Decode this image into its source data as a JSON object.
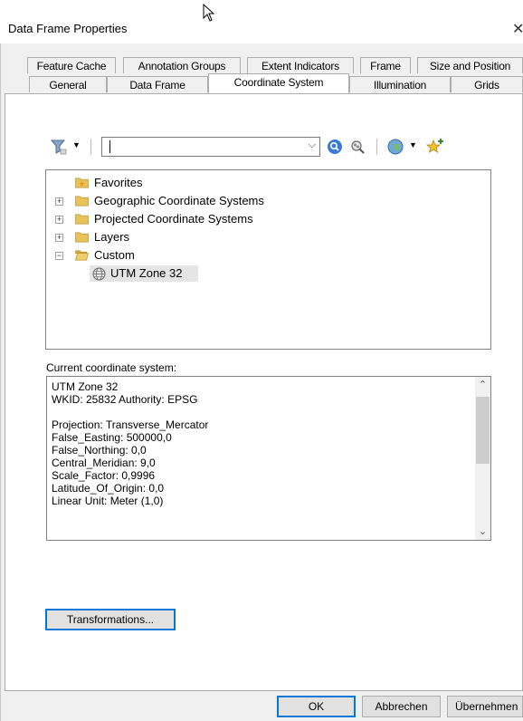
{
  "window": {
    "title": "Data Frame Properties"
  },
  "tabs_row1": [
    {
      "label": "Feature Cache"
    },
    {
      "label": "Annotation Groups"
    },
    {
      "label": "Extent Indicators"
    },
    {
      "label": "Frame"
    },
    {
      "label": "Size and Position"
    }
  ],
  "tabs_row2": [
    {
      "label": "General"
    },
    {
      "label": "Data Frame"
    },
    {
      "label": "Coordinate System",
      "active": true
    },
    {
      "label": "Illumination"
    },
    {
      "label": "Grids"
    }
  ],
  "toolbar": {
    "search_value": "",
    "icons": [
      "filter-icon",
      "search-icon",
      "search-options-icon",
      "globe-icon",
      "favorites-add-icon"
    ]
  },
  "tree": {
    "items": [
      {
        "label": "Favorites",
        "expander": ""
      },
      {
        "label": "Geographic Coordinate Systems",
        "expander": "+"
      },
      {
        "label": "Projected Coordinate Systems",
        "expander": "+"
      },
      {
        "label": "Layers",
        "expander": "+"
      },
      {
        "label": "Custom",
        "expander": "−"
      },
      {
        "label": "UTM Zone 32",
        "expander": ""
      }
    ]
  },
  "current": {
    "label": "Current coordinate system:",
    "lines": [
      "UTM Zone 32",
      "WKID: 25832 Authority: EPSG",
      "",
      "Projection: Transverse_Mercator",
      "False_Easting: 500000,0",
      "False_Northing: 0,0",
      "Central_Meridian: 9,0",
      "Scale_Factor: 0,9996",
      "Latitude_Of_Origin: 0,0",
      "Linear Unit: Meter (1,0)"
    ]
  },
  "buttons": {
    "transformations": "Transformations...",
    "ok": "OK",
    "cancel": "Abbrechen",
    "apply": "Übernehmen"
  },
  "colors": {
    "accent": "#0078d7",
    "folder": "#e8c25a"
  }
}
